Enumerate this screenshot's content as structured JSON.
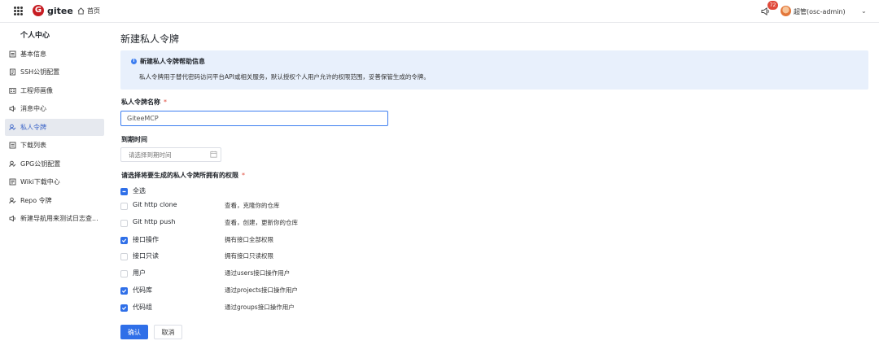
{
  "topbar": {
    "logo_text": "gitee",
    "home_label": "首页",
    "notification_count": "72",
    "user_name": "超管(osc-admin)"
  },
  "sidebar": {
    "title": "个人中心",
    "items": [
      {
        "label": "基本信息",
        "icon": "profile-card-icon"
      },
      {
        "label": "SSH公钥配置",
        "icon": "key-file-icon"
      },
      {
        "label": "工程师画像",
        "icon": "id-card-icon"
      },
      {
        "label": "消息中心",
        "icon": "speaker-icon"
      },
      {
        "label": "私人令牌",
        "icon": "user-token-icon",
        "active": true
      },
      {
        "label": "下载列表",
        "icon": "download-list-icon"
      },
      {
        "label": "GPG公钥配置",
        "icon": "user-key-icon"
      },
      {
        "label": "Wiki下载中心",
        "icon": "wiki-icon"
      },
      {
        "label": "Repo 令牌",
        "icon": "user-token-icon"
      },
      {
        "label": "新建导航用来测试日志查...",
        "icon": "speaker-icon"
      }
    ]
  },
  "page": {
    "title": "新建私人令牌",
    "help_title": "新建私人令牌帮助信息",
    "help_text": "私人令牌用于替代密码访问平台API或相关服务，默认授权个人用户允许的权限范围，妥善保管生成的令牌。",
    "name_label": "私人令牌名称",
    "required_mark": "*",
    "name_value": "GiteeMCP",
    "expire_label": "到期时间",
    "expire_placeholder": "请选择到期时间",
    "perms_label": "请选择将要生成的私人令牌所拥有的权限",
    "select_all_label": "全选",
    "permissions": [
      {
        "label": "Git http clone",
        "desc": "查看，克隆你的仓库",
        "checked": false
      },
      {
        "label": "Git http push",
        "desc": "查看，创建，更新你的仓库",
        "checked": false
      },
      {
        "label": "接口操作",
        "desc": "拥有接口全部权限",
        "checked": true
      },
      {
        "label": "接口只读",
        "desc": "拥有接口只读权限",
        "checked": false
      },
      {
        "label": "用户",
        "desc": "通过users接口操作用户",
        "checked": false
      },
      {
        "label": "代码库",
        "desc": "通过projects接口操作用户",
        "checked": true
      },
      {
        "label": "代码组",
        "desc": "通过groups接口操作用户",
        "checked": true
      }
    ],
    "confirm_label": "确认",
    "cancel_label": "取消"
  },
  "colors": {
    "primary": "#2f6fe8",
    "brand": "#c71d23",
    "help_bg": "#e8f0fc",
    "active_bg": "#e6e9ef",
    "required": "#e04a3b"
  }
}
